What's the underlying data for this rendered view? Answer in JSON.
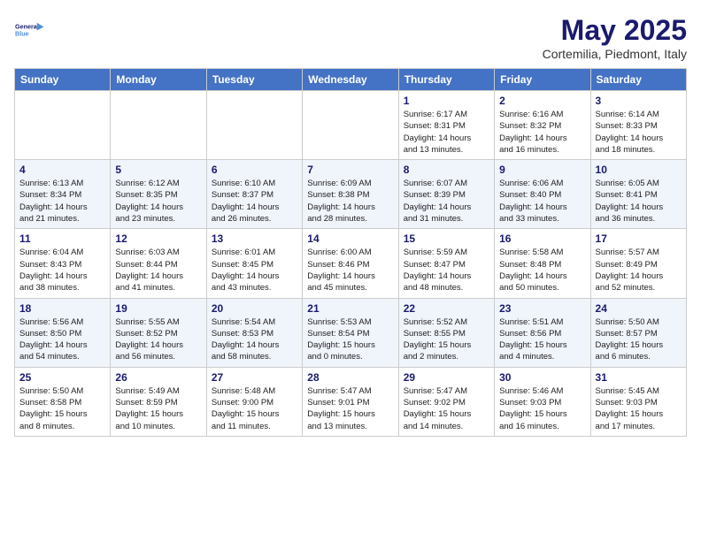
{
  "header": {
    "logo_line1": "General",
    "logo_line2": "Blue",
    "month": "May 2025",
    "location": "Cortemilia, Piedmont, Italy"
  },
  "weekdays": [
    "Sunday",
    "Monday",
    "Tuesday",
    "Wednesday",
    "Thursday",
    "Friday",
    "Saturday"
  ],
  "weeks": [
    [
      {
        "day": "",
        "info": ""
      },
      {
        "day": "",
        "info": ""
      },
      {
        "day": "",
        "info": ""
      },
      {
        "day": "",
        "info": ""
      },
      {
        "day": "1",
        "info": "Sunrise: 6:17 AM\nSunset: 8:31 PM\nDaylight: 14 hours\nand 13 minutes."
      },
      {
        "day": "2",
        "info": "Sunrise: 6:16 AM\nSunset: 8:32 PM\nDaylight: 14 hours\nand 16 minutes."
      },
      {
        "day": "3",
        "info": "Sunrise: 6:14 AM\nSunset: 8:33 PM\nDaylight: 14 hours\nand 18 minutes."
      }
    ],
    [
      {
        "day": "4",
        "info": "Sunrise: 6:13 AM\nSunset: 8:34 PM\nDaylight: 14 hours\nand 21 minutes."
      },
      {
        "day": "5",
        "info": "Sunrise: 6:12 AM\nSunset: 8:35 PM\nDaylight: 14 hours\nand 23 minutes."
      },
      {
        "day": "6",
        "info": "Sunrise: 6:10 AM\nSunset: 8:37 PM\nDaylight: 14 hours\nand 26 minutes."
      },
      {
        "day": "7",
        "info": "Sunrise: 6:09 AM\nSunset: 8:38 PM\nDaylight: 14 hours\nand 28 minutes."
      },
      {
        "day": "8",
        "info": "Sunrise: 6:07 AM\nSunset: 8:39 PM\nDaylight: 14 hours\nand 31 minutes."
      },
      {
        "day": "9",
        "info": "Sunrise: 6:06 AM\nSunset: 8:40 PM\nDaylight: 14 hours\nand 33 minutes."
      },
      {
        "day": "10",
        "info": "Sunrise: 6:05 AM\nSunset: 8:41 PM\nDaylight: 14 hours\nand 36 minutes."
      }
    ],
    [
      {
        "day": "11",
        "info": "Sunrise: 6:04 AM\nSunset: 8:43 PM\nDaylight: 14 hours\nand 38 minutes."
      },
      {
        "day": "12",
        "info": "Sunrise: 6:03 AM\nSunset: 8:44 PM\nDaylight: 14 hours\nand 41 minutes."
      },
      {
        "day": "13",
        "info": "Sunrise: 6:01 AM\nSunset: 8:45 PM\nDaylight: 14 hours\nand 43 minutes."
      },
      {
        "day": "14",
        "info": "Sunrise: 6:00 AM\nSunset: 8:46 PM\nDaylight: 14 hours\nand 45 minutes."
      },
      {
        "day": "15",
        "info": "Sunrise: 5:59 AM\nSunset: 8:47 PM\nDaylight: 14 hours\nand 48 minutes."
      },
      {
        "day": "16",
        "info": "Sunrise: 5:58 AM\nSunset: 8:48 PM\nDaylight: 14 hours\nand 50 minutes."
      },
      {
        "day": "17",
        "info": "Sunrise: 5:57 AM\nSunset: 8:49 PM\nDaylight: 14 hours\nand 52 minutes."
      }
    ],
    [
      {
        "day": "18",
        "info": "Sunrise: 5:56 AM\nSunset: 8:50 PM\nDaylight: 14 hours\nand 54 minutes."
      },
      {
        "day": "19",
        "info": "Sunrise: 5:55 AM\nSunset: 8:52 PM\nDaylight: 14 hours\nand 56 minutes."
      },
      {
        "day": "20",
        "info": "Sunrise: 5:54 AM\nSunset: 8:53 PM\nDaylight: 14 hours\nand 58 minutes."
      },
      {
        "day": "21",
        "info": "Sunrise: 5:53 AM\nSunset: 8:54 PM\nDaylight: 15 hours\nand 0 minutes."
      },
      {
        "day": "22",
        "info": "Sunrise: 5:52 AM\nSunset: 8:55 PM\nDaylight: 15 hours\nand 2 minutes."
      },
      {
        "day": "23",
        "info": "Sunrise: 5:51 AM\nSunset: 8:56 PM\nDaylight: 15 hours\nand 4 minutes."
      },
      {
        "day": "24",
        "info": "Sunrise: 5:50 AM\nSunset: 8:57 PM\nDaylight: 15 hours\nand 6 minutes."
      }
    ],
    [
      {
        "day": "25",
        "info": "Sunrise: 5:50 AM\nSunset: 8:58 PM\nDaylight: 15 hours\nand 8 minutes."
      },
      {
        "day": "26",
        "info": "Sunrise: 5:49 AM\nSunset: 8:59 PM\nDaylight: 15 hours\nand 10 minutes."
      },
      {
        "day": "27",
        "info": "Sunrise: 5:48 AM\nSunset: 9:00 PM\nDaylight: 15 hours\nand 11 minutes."
      },
      {
        "day": "28",
        "info": "Sunrise: 5:47 AM\nSunset: 9:01 PM\nDaylight: 15 hours\nand 13 minutes."
      },
      {
        "day": "29",
        "info": "Sunrise: 5:47 AM\nSunset: 9:02 PM\nDaylight: 15 hours\nand 14 minutes."
      },
      {
        "day": "30",
        "info": "Sunrise: 5:46 AM\nSunset: 9:03 PM\nDaylight: 15 hours\nand 16 minutes."
      },
      {
        "day": "31",
        "info": "Sunrise: 5:45 AM\nSunset: 9:03 PM\nDaylight: 15 hours\nand 17 minutes."
      }
    ]
  ]
}
